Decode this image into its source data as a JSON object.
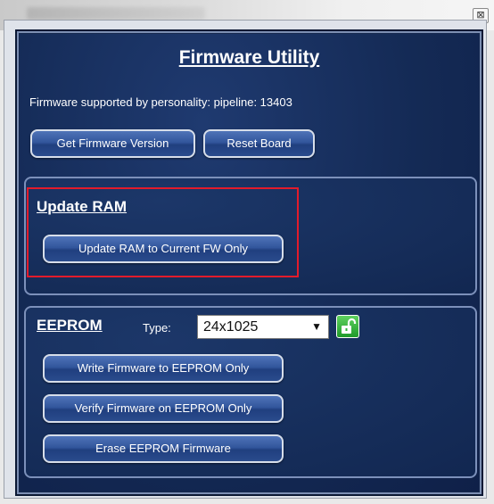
{
  "window": {
    "close_glyph": "⊠"
  },
  "dialog": {
    "title": "Firmware Utility",
    "supported_text": "Firmware supported by personality: pipeline: 13403",
    "get_version_label": "Get Firmware Version",
    "reset_board_label": "Reset Board"
  },
  "ram_group": {
    "title": "Update RAM",
    "update_ram_label": "Update RAM to Current FW Only"
  },
  "eeprom_group": {
    "title": "EEPROM",
    "type_label": "Type:",
    "type_value": "24x1025",
    "write_label": "Write Firmware to EEPROM Only",
    "verify_label": "Verify Firmware on EEPROM Only",
    "erase_label": "Erase EEPROM Firmware"
  },
  "icons": {
    "lock": "unlock-icon",
    "dropdown": "chevron-down-icon"
  },
  "colors": {
    "dialog_bg": "#142a55",
    "highlight": "#e21b2b",
    "lock_green": "#2fb53a"
  }
}
